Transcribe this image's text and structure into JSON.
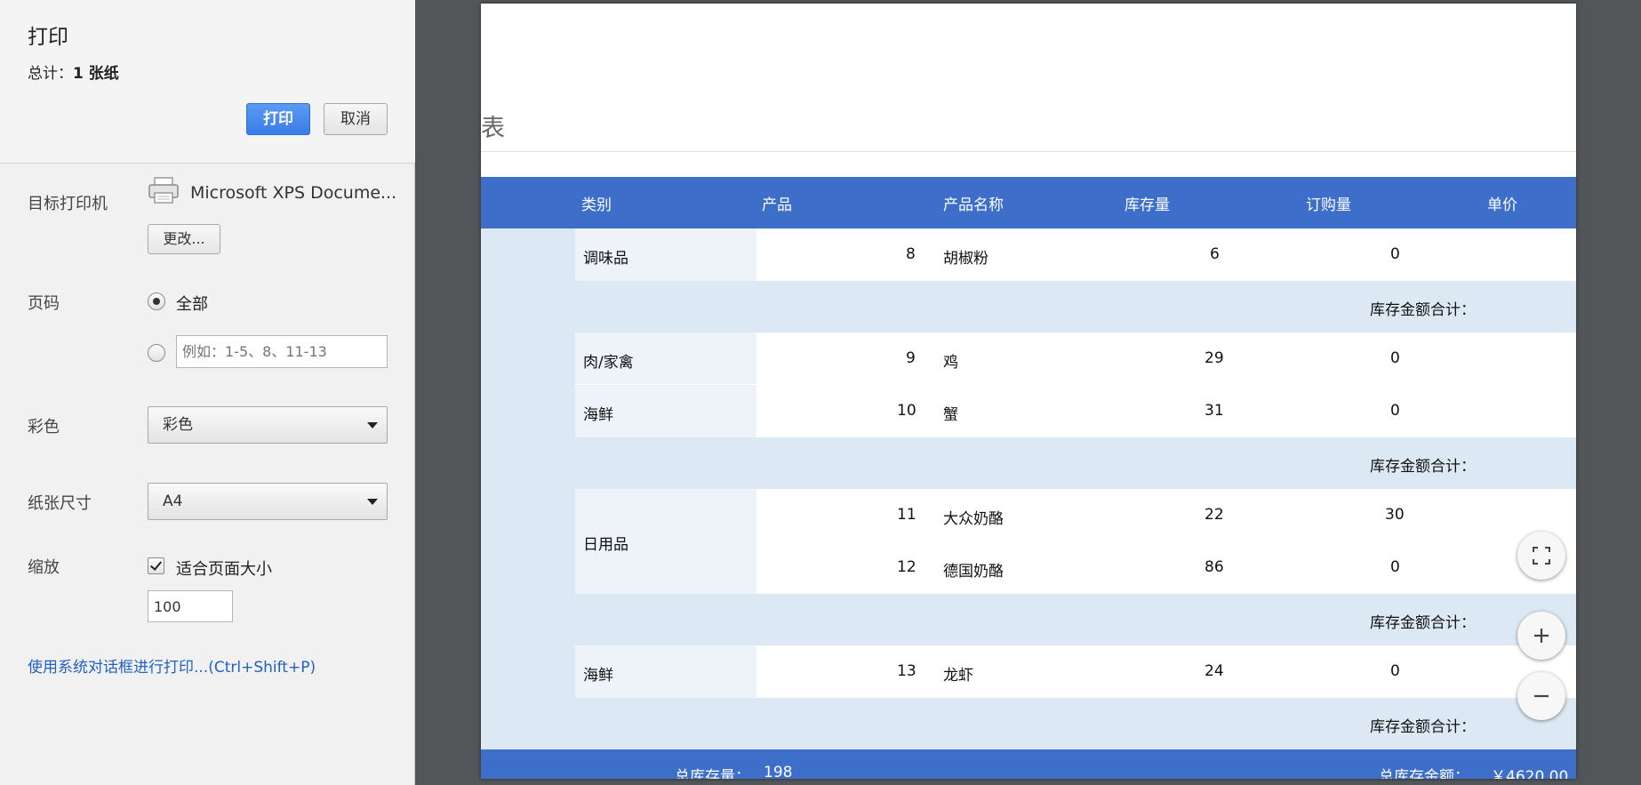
{
  "panel": {
    "title": "打印",
    "summary_label": "总计：",
    "summary_value": "1 张纸",
    "print_label": "打印",
    "cancel_label": "取消",
    "destination_label": "目标打印机",
    "destination_name": "Microsoft XPS Docume...",
    "change_label": "更改...",
    "pages_label": "页码",
    "pages_all_label": "全部",
    "pages_placeholder": "例如：1-5、8、11-13",
    "color_label": "彩色",
    "color_value": "彩色",
    "paper_label": "纸张尺寸",
    "paper_value": "A4",
    "scale_label": "缩放",
    "fit_label": "适合页面大小",
    "scale_value": "100",
    "system_dialog_link": "使用系统对话框进行打印...(Ctrl+Shift+P)"
  },
  "preview": {
    "title": "表",
    "columns": [
      "类别",
      "产品",
      "产品名称",
      "库存量",
      "订购量",
      "单价"
    ],
    "groups": [
      {
        "rows": [
          {
            "category": "调味品",
            "id": "8",
            "name": "胡椒粉",
            "stock": "6",
            "ordered": "0"
          }
        ]
      },
      {
        "rows": [
          {
            "category": "肉/家禽",
            "id": "9",
            "name": "鸡",
            "stock": "29",
            "ordered": "0"
          },
          {
            "category": "海鲜",
            "id": "10",
            "name": "蟹",
            "stock": "31",
            "ordered": "0"
          }
        ]
      },
      {
        "category": "日用品",
        "rows": [
          {
            "id": "11",
            "name": "大众奶酪",
            "stock": "22",
            "ordered": "30"
          },
          {
            "id": "12",
            "name": "德国奶酪",
            "stock": "86",
            "ordered": "0"
          }
        ]
      },
      {
        "rows": [
          {
            "category": "海鲜",
            "id": "13",
            "name": "龙虾",
            "stock": "24",
            "ordered": "0"
          }
        ]
      }
    ],
    "subtotal_label": "库存金额合计：",
    "footer_stock_label": "总库存量：",
    "footer_stock_value": "198",
    "footer_amount_label": "总库存金额：",
    "footer_amount_value": "￥4620.00"
  },
  "icons": {
    "printer": "printer-icon",
    "fit": "fit-to-page-icon",
    "zoom_in": "zoom-in-icon",
    "zoom_out": "zoom-out-icon"
  }
}
